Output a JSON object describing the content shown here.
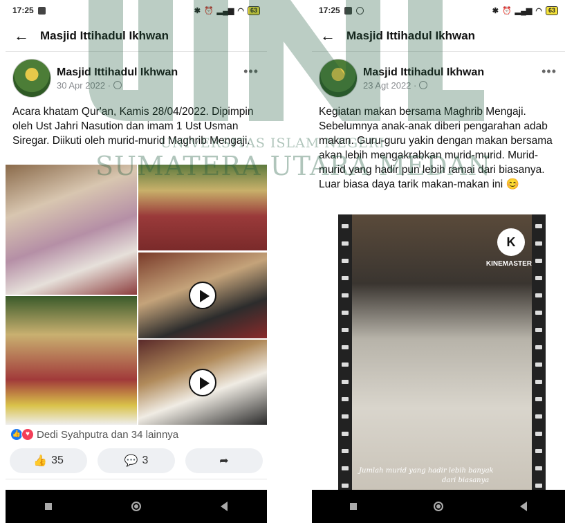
{
  "left": {
    "status": {
      "time": "17:25",
      "battery": "63"
    },
    "header": {
      "title": "Masjid Ittihadul Ikhwan"
    },
    "post": {
      "page_name": "Masjid Ittihadul Ikhwan",
      "date": "30 Apr 2022 ·",
      "text": "Acara khatam Qur'an, Kamis 28/04/2022. Dipimpin oleh Ust Jahri Nasution dan imam 1 Ust Usman Siregar. Diikuti oleh murid-murid Maghrib Mengaji.",
      "reactions": "Dedi Syahputra dan 34 lainnya",
      "likes": "35",
      "comments": "3"
    }
  },
  "right": {
    "status": {
      "time": "17:25",
      "battery": "63"
    },
    "header": {
      "title": "Masjid Ittihadul Ikhwan"
    },
    "post": {
      "page_name": "Masjid Ittihadul Ikhwan",
      "date": "23 Agt 2022 ·",
      "text": "Kegiatan makan bersama Maghrib Mengaji. Sebelumnya anak-anak diberi pengarahan adab makan. Guru-guru yakin dengan makan bersama akan lebih mengakrabkan murid-murid. Murid-murid yang hadir pun lebih ramai dari biasanya. Luar biasa daya tarik makan-makan ini 😊",
      "video_brand": "KINEMASTER",
      "video_logo": "K",
      "video_caption_1": "Jumlah murid yang hadir lebih banyak",
      "video_caption_2": "dari biasanya"
    }
  },
  "watermark": {
    "line1": "UNIVERSITAS ISLAM NEGERI",
    "line2": "SUMATERA UTARA MEDAN"
  },
  "colors": {
    "accent": "#1877f2",
    "love": "#f33e58",
    "watermark": "#1e5a3c"
  }
}
